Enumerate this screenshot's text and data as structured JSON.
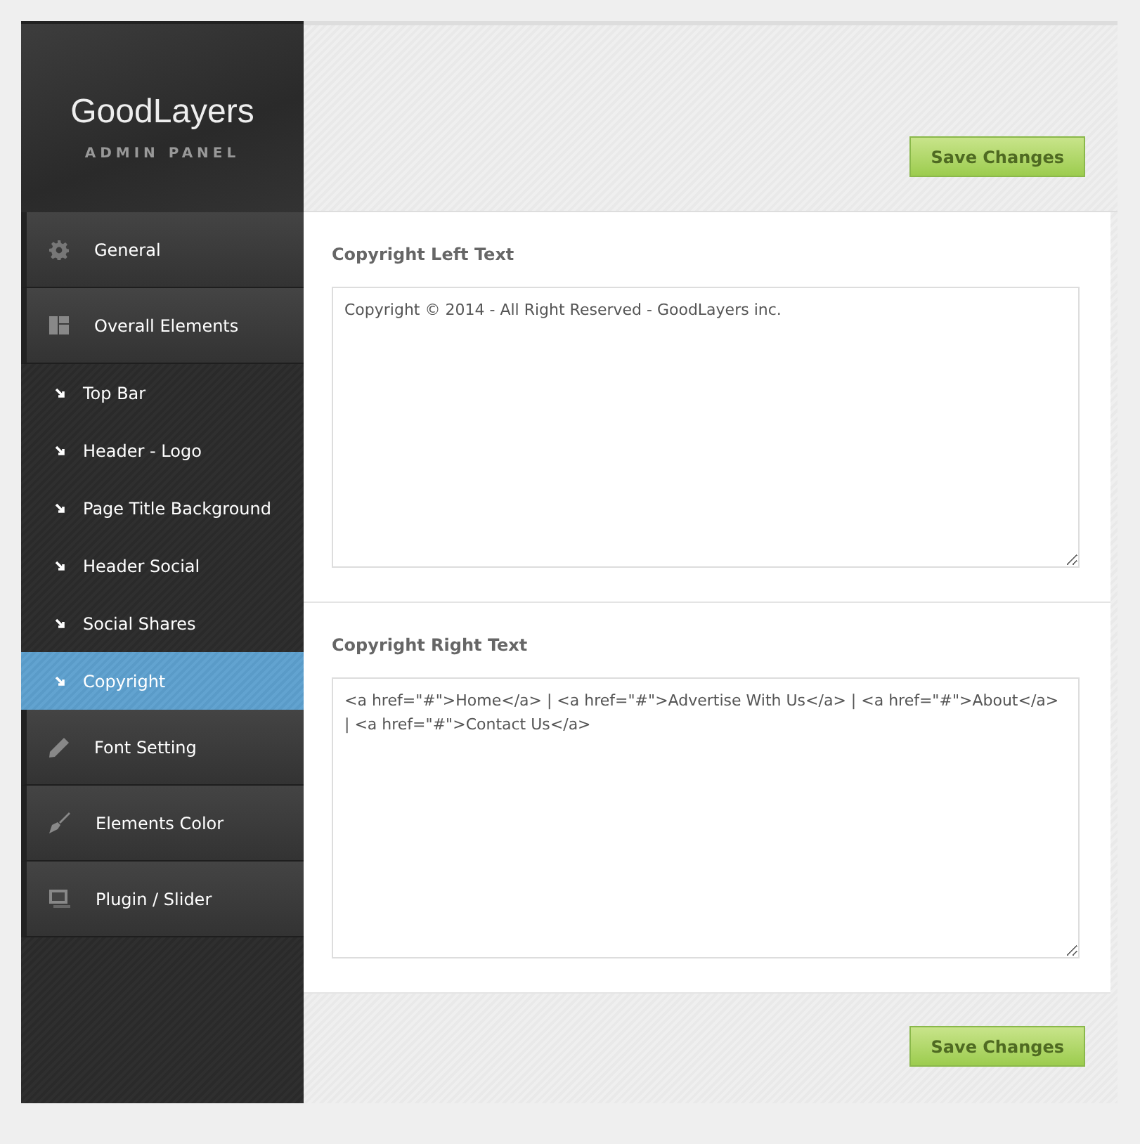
{
  "logo": {
    "title": "GoodLayers",
    "subtitle": "ADMIN PANEL"
  },
  "nav": [
    {
      "kind": "section",
      "label": "General",
      "selected": false
    },
    {
      "kind": "section",
      "label": "Overall Elements",
      "selected": false
    },
    {
      "kind": "sub",
      "label": "Top Bar",
      "selected": false
    },
    {
      "kind": "sub",
      "label": "Header - Logo",
      "selected": false
    },
    {
      "kind": "sub",
      "label": "Page Title Background",
      "selected": false
    },
    {
      "kind": "sub",
      "label": "Header Social",
      "selected": false
    },
    {
      "kind": "sub",
      "label": "Social Shares",
      "selected": false
    },
    {
      "kind": "sub",
      "label": "Copyright",
      "selected": true
    },
    {
      "kind": "section",
      "label": "Font Setting",
      "selected": false
    },
    {
      "kind": "section",
      "label": "Elements Color",
      "selected": false
    },
    {
      "kind": "section",
      "label": "Plugin / Slider",
      "selected": false
    }
  ],
  "save_button_top": "Save Changes",
  "fields": [
    {
      "label": "Copyright Left Text",
      "value": "Copyright © 2014 - All Right Reserved - GoodLayers inc."
    },
    {
      "label": "Copyright Right Text",
      "value": "<a href=\"#\">Home</a> | <a href=\"#\">Advertise With Us</a> | <a href=\"#\">About</a> | <a href=\"#\">Contact Us</a>"
    }
  ],
  "save_button_bottom": "Save Changes"
}
